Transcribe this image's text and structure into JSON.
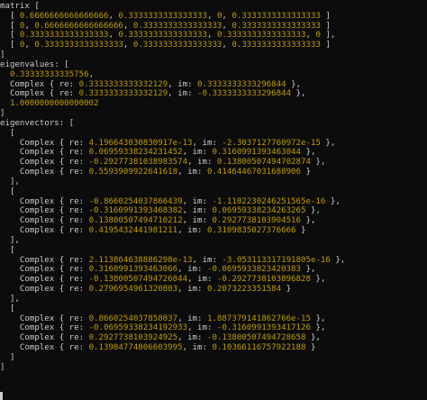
{
  "window": {
    "background": "#0c0c0c"
  },
  "colors": {
    "text": "#cccccc",
    "number": "#c19c00"
  },
  "lines": [
    [
      [
        "t",
        "matrix ["
      ]
    ],
    [
      [
        "t",
        "  [ "
      ],
      [
        "n",
        "0.6666666666666666"
      ],
      [
        "t",
        ", "
      ],
      [
        "n",
        "0.3333333333333333"
      ],
      [
        "t",
        ", "
      ],
      [
        "n",
        "0"
      ],
      [
        "t",
        ", "
      ],
      [
        "n",
        "0.3333333333333333"
      ],
      [
        "t",
        " ]"
      ]
    ],
    [
      [
        "t",
        "  [ "
      ],
      [
        "n",
        "0"
      ],
      [
        "t",
        ", "
      ],
      [
        "n",
        "0.6666666666666666"
      ],
      [
        "t",
        ", "
      ],
      [
        "n",
        "0.3333333333333333"
      ],
      [
        "t",
        ", "
      ],
      [
        "n",
        "0.3333333333333333"
      ],
      [
        "t",
        " ]"
      ]
    ],
    [
      [
        "t",
        "  [ "
      ],
      [
        "n",
        "0.3333333333333333"
      ],
      [
        "t",
        ", "
      ],
      [
        "n",
        "0.3333333333333333"
      ],
      [
        "t",
        ", "
      ],
      [
        "n",
        "0.3333333333333333"
      ],
      [
        "t",
        ", "
      ],
      [
        "n",
        "0"
      ],
      [
        "t",
        " ],"
      ]
    ],
    [
      [
        "t",
        "  [ "
      ],
      [
        "n",
        "0"
      ],
      [
        "t",
        ", "
      ],
      [
        "n",
        "0.3333333333333333"
      ],
      [
        "t",
        ", "
      ],
      [
        "n",
        "0.3333333333333333"
      ],
      [
        "t",
        ", "
      ],
      [
        "n",
        "0.3333333333333333"
      ],
      [
        "t",
        " ]"
      ]
    ],
    [
      [
        "t",
        "]"
      ]
    ],
    [
      [
        "t",
        "eigenvalues: ["
      ]
    ],
    [
      [
        "t",
        "  "
      ],
      [
        "n",
        "0.33333333335756"
      ],
      [
        "t",
        ","
      ]
    ],
    [
      [
        "t",
        "  Complex { re: "
      ],
      [
        "n",
        "0.3333333333332129"
      ],
      [
        "t",
        ", im: "
      ],
      [
        "n",
        "0.3333333333296844"
      ],
      [
        "t",
        " },"
      ]
    ],
    [
      [
        "t",
        "  Complex { re: "
      ],
      [
        "n",
        "0.3333333333332129"
      ],
      [
        "t",
        ", im: "
      ],
      [
        "n",
        "-0.3333333333296844"
      ],
      [
        "t",
        " },"
      ]
    ],
    [
      [
        "t",
        "  "
      ],
      [
        "n",
        "1.0000000000000002"
      ]
    ],
    [
      [
        "t",
        "]"
      ]
    ],
    [
      [
        "t",
        "eigenvectors: ["
      ]
    ],
    [
      [
        "t",
        "  ["
      ]
    ],
    [
      [
        "t",
        "    Complex { re: "
      ],
      [
        "n",
        "4.196643030830917e-13"
      ],
      [
        "t",
        ", im: "
      ],
      [
        "n",
        "-2.3037127760972e-15"
      ],
      [
        "t",
        " },"
      ]
    ],
    [
      [
        "t",
        "    Complex { re: "
      ],
      [
        "n",
        "0.06959338234231452"
      ],
      [
        "t",
        ", im: "
      ],
      [
        "n",
        "0.3160991393463044"
      ],
      [
        "t",
        " },"
      ]
    ],
    [
      [
        "t",
        "    Complex { re: "
      ],
      [
        "n",
        "-0.29277381038983574"
      ],
      [
        "t",
        ", im: "
      ],
      [
        "n",
        "0.13800507494702874"
      ],
      [
        "t",
        " },"
      ]
    ],
    [
      [
        "t",
        "    Complex { re: "
      ],
      [
        "n",
        "0.5593909922641618"
      ],
      [
        "t",
        ", im: "
      ],
      [
        "n",
        "0.41464467031688906"
      ],
      [
        "t",
        " }"
      ]
    ],
    [
      [
        "t",
        "  ],"
      ]
    ],
    [
      [
        "t",
        "  ["
      ]
    ],
    [
      [
        "t",
        "    Complex { re: "
      ],
      [
        "n",
        "-0.8660254037866439"
      ],
      [
        "t",
        ", im: "
      ],
      [
        "n",
        "-1.1102230246251565e-16"
      ],
      [
        "t",
        " },"
      ]
    ],
    [
      [
        "t",
        "    Complex { re: "
      ],
      [
        "n",
        "-0.3160991393468382"
      ],
      [
        "t",
        ", im: "
      ],
      [
        "n",
        "0.06959338234263265"
      ],
      [
        "t",
        " },"
      ]
    ],
    [
      [
        "t",
        "    Complex { re: "
      ],
      [
        "n",
        "0.13800507494710212"
      ],
      [
        "t",
        ", im: "
      ],
      [
        "n",
        "0.2927738103904516"
      ],
      [
        "t",
        " },"
      ]
    ],
    [
      [
        "t",
        "    Complex { re: "
      ],
      [
        "n",
        "0.4195432441981211"
      ],
      [
        "t",
        ", im: "
      ],
      [
        "n",
        "0.3109835027376666"
      ],
      [
        "t",
        " }"
      ]
    ],
    [
      [
        "t",
        "  ],"
      ]
    ],
    [
      [
        "t",
        "  ["
      ]
    ],
    [
      [
        "t",
        "    Complex { re: "
      ],
      [
        "n",
        "2.113864638886298e-13"
      ],
      [
        "t",
        ", im: "
      ],
      [
        "n",
        "-3.053113317191805e-16"
      ],
      [
        "t",
        " },"
      ]
    ],
    [
      [
        "t",
        "    Complex { re: "
      ],
      [
        "n",
        "0.3160991393463066"
      ],
      [
        "t",
        ", im: "
      ],
      [
        "n",
        "-0.0695933823420383"
      ],
      [
        "t",
        " },"
      ]
    ],
    [
      [
        "t",
        "    Complex { re: "
      ],
      [
        "n",
        "-0.13800507494726044"
      ],
      [
        "t",
        ", im: "
      ],
      [
        "n",
        "-0.2927738103896828"
      ],
      [
        "t",
        " },"
      ]
    ],
    [
      [
        "t",
        "    Complex { re: "
      ],
      [
        "n",
        "0.2796954961320803"
      ],
      [
        "t",
        ", im: "
      ],
      [
        "n",
        "0.2073223351584"
      ],
      [
        "t",
        " }"
      ]
    ],
    [
      [
        "t",
        "  ],"
      ]
    ],
    [
      [
        "t",
        "  ["
      ]
    ],
    [
      [
        "t",
        "    Complex { re: "
      ],
      [
        "n",
        "0.8660254037858037"
      ],
      [
        "t",
        ", im: "
      ],
      [
        "n",
        "1.887379141862766e-15"
      ],
      [
        "t",
        " },"
      ]
    ],
    [
      [
        "t",
        "    Complex { re: "
      ],
      [
        "n",
        "-0.06959338234192933"
      ],
      [
        "t",
        ", im: "
      ],
      [
        "n",
        "-0.3160991393417126"
      ],
      [
        "t",
        " },"
      ]
    ],
    [
      [
        "t",
        "    Complex { re: "
      ],
      [
        "n",
        "0.2927738103924925"
      ],
      [
        "t",
        ", im: "
      ],
      [
        "n",
        "-0.13800507494728658"
      ],
      [
        "t",
        " },"
      ]
    ],
    [
      [
        "t",
        "    Complex { re: "
      ],
      [
        "n",
        "0.13984774806603995"
      ],
      [
        "t",
        ", im: "
      ],
      [
        "n",
        "0.10366116757922188"
      ],
      [
        "t",
        " }"
      ]
    ],
    [
      [
        "t",
        "  ]"
      ]
    ],
    [
      [
        "t",
        "]"
      ]
    ],
    [
      [
        "t",
        ""
      ]
    ],
    [
      [
        "t",
        ""
      ]
    ],
    [
      [
        "c",
        ""
      ]
    ]
  ]
}
